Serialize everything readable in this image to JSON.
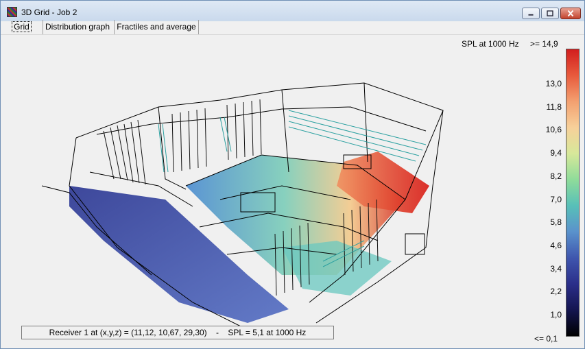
{
  "window": {
    "title": "3D Grid - Job 2",
    "minimize_icon": "minimize-icon",
    "maximize_icon": "maximize-icon",
    "close_icon": "close-icon"
  },
  "tabs": [
    {
      "label": "Grid",
      "selected": true
    },
    {
      "label": "Distribution graph",
      "selected": false
    },
    {
      "label": "Fractiles and average",
      "selected": false
    }
  ],
  "legend": {
    "title": "SPL at 1000 Hz",
    "max_label": ">= 14,9",
    "min_label": "<= 0,1",
    "ticks": [
      "13,0",
      "11,8",
      "10,6",
      "9,4",
      "8,2",
      "7,0",
      "5,8",
      "4,6",
      "3,4",
      "2,2",
      "1,0"
    ],
    "colors": [
      "#d21e1e",
      "#e85a3c",
      "#f3a070",
      "#f7d09a",
      "#d7e89a",
      "#8fdc9a",
      "#58c0b8",
      "#5a92cc",
      "#3f56ae",
      "#2b2f8a",
      "#141550",
      "#000000"
    ]
  },
  "status": {
    "text": "Receiver 1 at (x,y,z) = (11,12, 10,67, 29,30)    -    SPL = 5,1 at 1000 Hz"
  }
}
